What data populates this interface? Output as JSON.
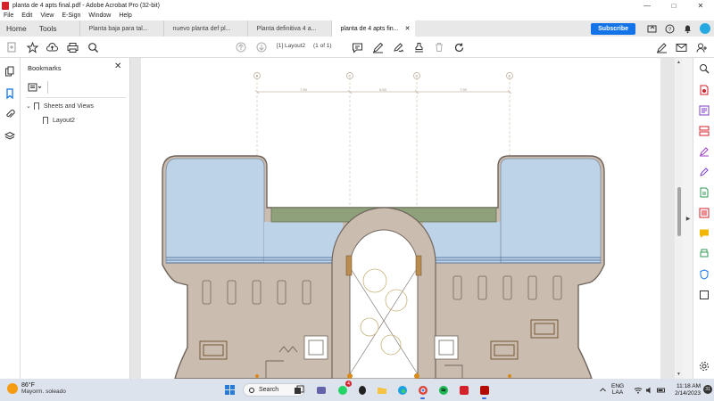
{
  "window": {
    "title": "planta de 4 apts final.pdf - Adobe Acrobat Pro (32-bit)",
    "controls": [
      "—",
      "□",
      "✕"
    ]
  },
  "menu": [
    "File",
    "Edit",
    "View",
    "E-Sign",
    "Window",
    "Help"
  ],
  "tabs": {
    "home": "Home",
    "tools": "Tools",
    "documents": [
      {
        "label": "Planta baja para tal...",
        "active": false
      },
      {
        "label": "nuevo planta def pl...",
        "active": false
      },
      {
        "label": "Planta definitiva 4 a...",
        "active": false
      },
      {
        "label": "planta de 4 apts fin...",
        "active": true
      }
    ],
    "close_glyph": "✕",
    "subscribe": "Subscribe"
  },
  "toolbar": {
    "page_indicator": "[1] Layout2",
    "page_count": "(1 of 1)"
  },
  "bookmarks": {
    "title": "Bookmarks",
    "close_glyph": "✕",
    "items": [
      {
        "label": "Sheets and Views",
        "expanded": true
      },
      {
        "label": "Layout2"
      }
    ]
  },
  "drawing": {
    "grid_labels": [
      "B",
      "C",
      "D",
      "E"
    ],
    "dimensions": [
      "7.90",
      "5.50",
      "7.90"
    ]
  },
  "taskbar": {
    "weather_temp": "86°F",
    "weather_condition": "Mayorm. soleado",
    "search_label": "Search",
    "language_top": "ENG",
    "language_bottom": "LAA",
    "time": "11:18 AM",
    "date": "2/14/2023",
    "notification_count": "31",
    "whatsapp_badge": "4"
  },
  "colors": {
    "accent": "#1473e6",
    "acrobat_red": "#d4212a",
    "floor_fill": "#cbbcb0",
    "pool_fill": "#bdd3e8",
    "planter_fill": "#8fa17a"
  }
}
